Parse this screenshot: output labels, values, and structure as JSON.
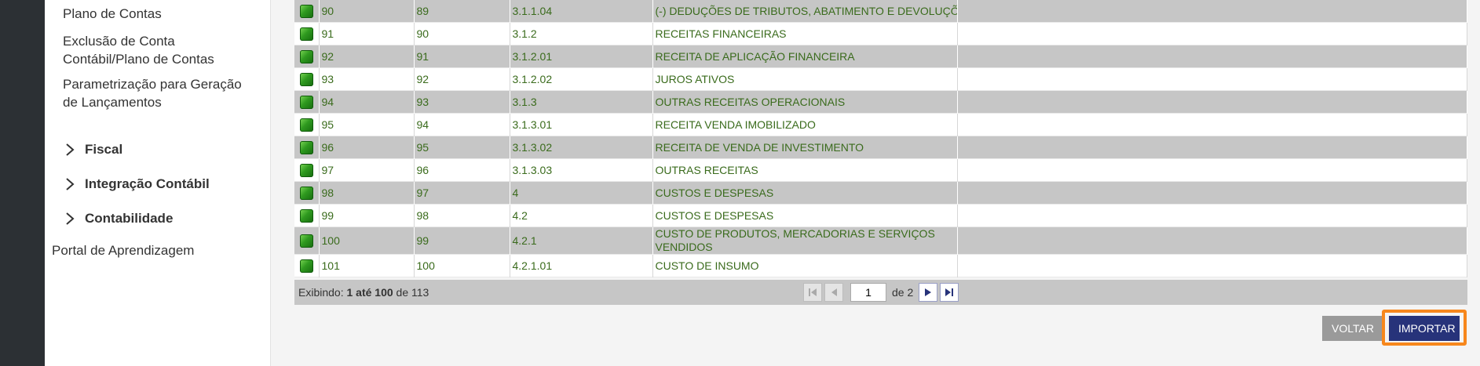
{
  "sidebar": {
    "links": [
      {
        "label": "Plano de Contas"
      },
      {
        "label": "Exclusão de Conta Contábil/Plano de Contas"
      },
      {
        "label": "Parametrização para Geração de Lançamentos"
      }
    ],
    "groups": [
      {
        "label": "Fiscal"
      },
      {
        "label": "Integração Contábil"
      },
      {
        "label": "Contabilidade"
      }
    ],
    "portal": "Portal de Aprendizagem"
  },
  "table": {
    "rows": [
      {
        "seq": "90",
        "parent": "89",
        "code": "3.1.1.04",
        "desc": "(-) DEDUÇÕES DE TRIBUTOS, ABATIMENTO E DEVOLUÇÕES"
      },
      {
        "seq": "91",
        "parent": "90",
        "code": "3.1.2",
        "desc": "RECEITAS FINANCEIRAS"
      },
      {
        "seq": "92",
        "parent": "91",
        "code": "3.1.2.01",
        "desc": "RECEITA DE APLICAÇÃO FINANCEIRA"
      },
      {
        "seq": "93",
        "parent": "92",
        "code": "3.1.2.02",
        "desc": "JUROS ATIVOS"
      },
      {
        "seq": "94",
        "parent": "93",
        "code": "3.1.3",
        "desc": "OUTRAS RECEITAS OPERACIONAIS"
      },
      {
        "seq": "95",
        "parent": "94",
        "code": "3.1.3.01",
        "desc": "RECEITA VENDA IMOBILIZADO"
      },
      {
        "seq": "96",
        "parent": "95",
        "code": "3.1.3.02",
        "desc": "RECEITA DE VENDA DE INVESTIMENTO"
      },
      {
        "seq": "97",
        "parent": "96",
        "code": "3.1.3.03",
        "desc": "OUTRAS RECEITAS"
      },
      {
        "seq": "98",
        "parent": "97",
        "code": "4",
        "desc": "CUSTOS E DESPESAS"
      },
      {
        "seq": "99",
        "parent": "98",
        "code": "4.2",
        "desc": "CUSTOS E DESPESAS"
      },
      {
        "seq": "100",
        "parent": "99",
        "code": "4.2.1",
        "desc": "CUSTO DE PRODUTOS, MERCADORIAS E SERVIÇOS VENDIDOS"
      },
      {
        "seq": "101",
        "parent": "100",
        "code": "4.2.1.01",
        "desc": "CUSTO DE INSUMO"
      }
    ]
  },
  "pager": {
    "info_prefix": "Exibindo: ",
    "info_range": "1 até 100",
    "info_of": " de 113",
    "page_value": "1",
    "of_pages": "de 2"
  },
  "buttons": {
    "back": "VOLTAR",
    "import": "IMPORTAR"
  },
  "colors": {
    "row_text": "#3a6b1c",
    "import_button": "#27337a",
    "import_highlight": "#f7871c"
  }
}
